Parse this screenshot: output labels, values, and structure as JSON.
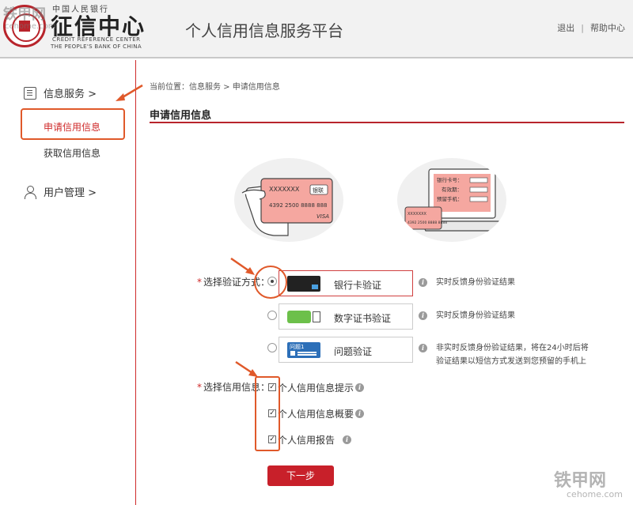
{
  "header": {
    "logo_top": "中国人民银行",
    "logo_main": "征信中心",
    "logo_en_line1": "CREDIT REFERENCE CENTER",
    "logo_en_line2": "THE PEOPLE'S BANK OF CHINA",
    "platform_title": "个人信用信息服务平台",
    "logout": "退出",
    "divider": "|",
    "help": "帮助中心"
  },
  "watermark": {
    "top_left": "铁甲网",
    "top_left_sub": "cehome.com",
    "bottom_right": "铁甲网",
    "bottom_right_sub": "cehome.com"
  },
  "sidebar": {
    "groups": [
      {
        "label": "信息服务 >",
        "icon": "document-icon",
        "items": [
          {
            "label": "申请信用信息",
            "active": true
          },
          {
            "label": "获取信用信息",
            "active": false
          }
        ]
      },
      {
        "label": "用户管理 >",
        "icon": "user-icon",
        "items": []
      }
    ]
  },
  "main": {
    "breadcrumb": "当前位置：信息服务 > 申请信用信息",
    "section_title": "申请信用信息",
    "card_illustration": {
      "card_name": "XXXXXXX",
      "card_brand": "银联",
      "card_number": "4392 2500 8888 888",
      "card_network": "VISA"
    },
    "laptop_illustration": {
      "field1": "银行卡号：",
      "field2": "有效期：",
      "field3": "预留手机：",
      "card_name": "XXXXXXX",
      "card_number": "4392 2500 8888 8888"
    },
    "verify": {
      "label": "选择验证方式：",
      "required_mark": "*",
      "options": [
        {
          "label": "银行卡验证",
          "selected": true,
          "desc": "实时反馈身份验证结果",
          "desc2": ""
        },
        {
          "label": "数字证书验证",
          "selected": false,
          "desc": "实时反馈身份验证结果",
          "desc2": ""
        },
        {
          "label": "问题验证",
          "selected": false,
          "img_text": "问题1",
          "desc": "非实时反馈身份验证结果，将在24小时后将",
          "desc2": "验证结果以短信方式发送到您预留的手机上"
        }
      ]
    },
    "credit": {
      "label": "选择信用信息：",
      "required_mark": "*",
      "options": [
        {
          "label": "个人信用信息提示",
          "checked": true
        },
        {
          "label": "个人信用信息概要",
          "checked": true
        },
        {
          "label": "个人信用报告",
          "checked": true
        }
      ]
    },
    "next_button": "下一步",
    "info_glyph": "i",
    "check_glyph": "✓"
  },
  "colors": {
    "brand_red": "#c8202a",
    "annotation_orange": "#e0592a",
    "header_bg": "#f2f2f2"
  }
}
